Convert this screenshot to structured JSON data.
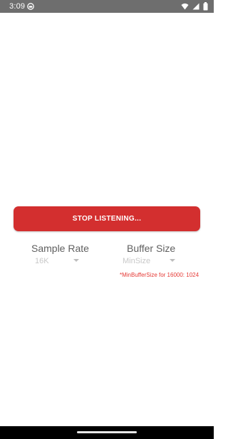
{
  "status_bar": {
    "time": "3:09",
    "app_icon": "app-notification-icon",
    "icons": [
      "wifi-icon",
      "signal-icon",
      "battery-icon"
    ]
  },
  "main": {
    "stop_button_label": "STOP LISTENING...",
    "sample_rate": {
      "label": "Sample Rate",
      "selected_value": "16K"
    },
    "buffer_size": {
      "label": "Buffer Size",
      "selected_value": "MinSize"
    },
    "min_buffer_note": "*MinBufferSize for 16000: 1024"
  },
  "colors": {
    "status_bar": "#6e6e6e",
    "button": "#d32f2f",
    "note": "#e53935",
    "label": "#5f5f5f",
    "spinner_text": "#c8c8c8",
    "nav_bar": "#000000"
  }
}
